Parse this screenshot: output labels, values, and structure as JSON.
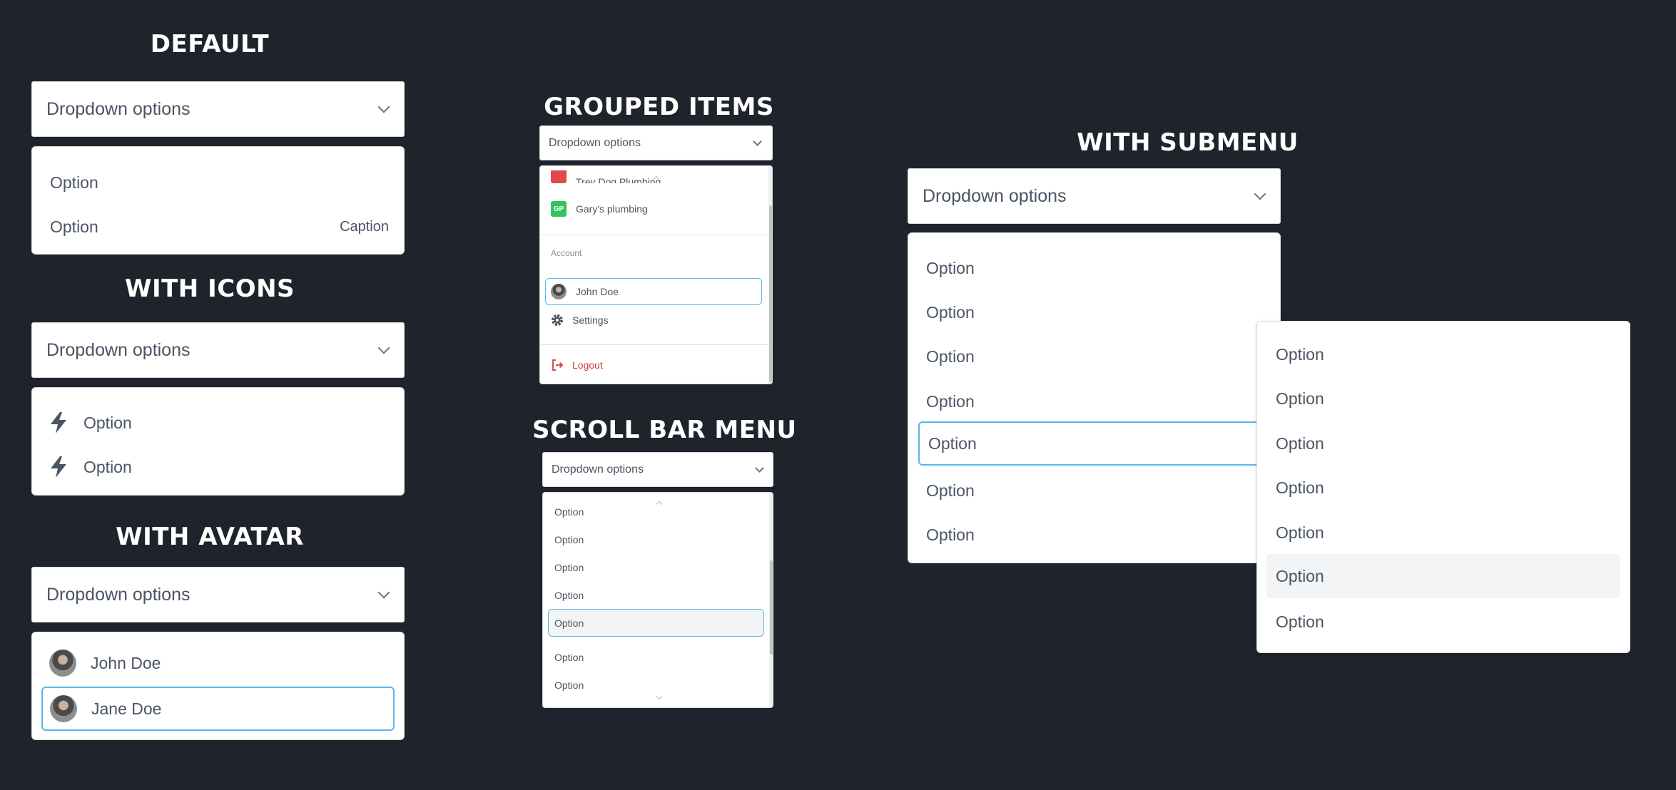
{
  "sections": {
    "default": "DEFAULT",
    "icons": "WITH ICONS",
    "avatar": "WITH AVATAR",
    "grouped": "GROUPED ITEMS",
    "scroll": "SCROLL BAR MENU",
    "submenu": "WITH SUBMENU"
  },
  "trigger_label": "Dropdown options",
  "default_menu": {
    "options": [
      "Option",
      "Option"
    ],
    "caption": "Caption"
  },
  "icons_menu": {
    "options": [
      "Option",
      "Option"
    ]
  },
  "avatar_menu": {
    "options": [
      "John Doe",
      "Jane Doe"
    ]
  },
  "grouped_menu": {
    "cut_item": "Trey Dog Plumbing",
    "gp_badge": "GP",
    "gary": "Gary's plumbing",
    "account_label": "Account",
    "user": "John Doe",
    "settings": "Settings",
    "logout": "Logout"
  },
  "scroll_menu": {
    "options": [
      "Option",
      "Option",
      "Option",
      "Option",
      "Option",
      "Option",
      "Option"
    ]
  },
  "submenu_menu": {
    "options": [
      "Option",
      "Option",
      "Option",
      "Option",
      "Option",
      "Option",
      "Option"
    ],
    "sub_options": [
      "Option",
      "Option",
      "Option",
      "Option",
      "Option",
      "Option",
      "Option"
    ]
  },
  "colors": {
    "background": "#1f232b",
    "selected_border": "#5bb7e6",
    "logout": "#d83a3a",
    "gp_badge": "#34c35b",
    "trey_badge": "#e4494a"
  },
  "icons": [
    "chevron-down-icon",
    "lightning-icon",
    "settings-icon",
    "logout-icon",
    "chevron-up-icon",
    "chevron-right-icon"
  ]
}
